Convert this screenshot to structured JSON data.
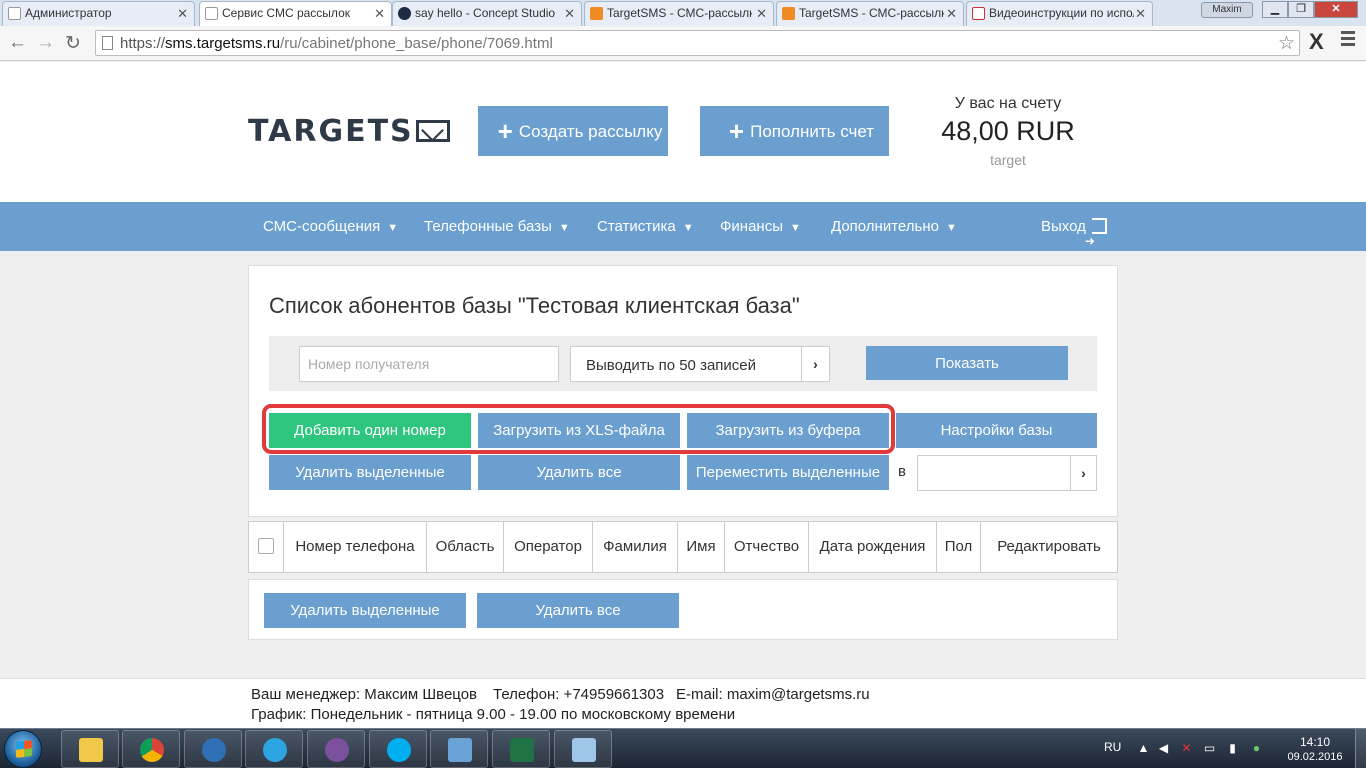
{
  "browser": {
    "tabs": [
      {
        "title": "Администратор",
        "icon": "page-icon",
        "active": false
      },
      {
        "title": "Сервис СМС рассылок",
        "icon": "page-icon",
        "active": true
      },
      {
        "title": "say hello - Concept Studio",
        "icon": "concept-studio-icon",
        "active": false
      },
      {
        "title": "TargetSMS - СМС-рассылки",
        "icon": "targetsms-icon",
        "active": false
      },
      {
        "title": "TargetSMS - СМС-рассылки",
        "icon": "targetsms-icon",
        "active": false
      },
      {
        "title": "Видеоинструкции по использованию",
        "icon": "gmail-icon",
        "active": false
      }
    ],
    "user": "Maxim",
    "url": {
      "scheme": "https://",
      "host": "sms.targetsms.ru",
      "path": "/ru/cabinet/phone_base/phone/7069.html"
    }
  },
  "header": {
    "logo": "TARGETS",
    "logo_suffix": "S",
    "create_button": "Создать рассылку",
    "topup_button": "Пополнить счет",
    "balance_caption": "У вас на счету",
    "balance_amount": "48,00 RUR",
    "account_login": "target"
  },
  "nav": {
    "items": [
      "СМС-сообщения",
      "Телефонные базы",
      "Статистика",
      "Финансы",
      "Дополнительно"
    ],
    "logout": "Выход"
  },
  "page": {
    "title": "Список абонентов базы \"Тестовая клиентская база\"",
    "search_placeholder": "Номер получателя",
    "per_page": "Выводить по 50 записей",
    "show_button": "Показать",
    "add_one": "Добавить один номер",
    "load_xls": "Загрузить из XLS-файла",
    "load_buffer": "Загрузить из буфера",
    "base_settings": "Настройки базы",
    "delete_selected": "Удалить выделенные",
    "delete_all": "Удалить все",
    "move_selected": "Переместить выделенные",
    "move_in_label": "в"
  },
  "table": {
    "columns": [
      "Номер телефона",
      "Область",
      "Оператор",
      "Фамилия",
      "Имя",
      "Отчество",
      "Дата рождения",
      "Пол",
      "Редактировать"
    ]
  },
  "bottom": {
    "delete_selected": "Удалить выделенные",
    "delete_all": "Удалить все"
  },
  "footer": {
    "manager": "Ваш менеджер: Максим Швецов",
    "phone": "Телефон: +74959661303",
    "email": "E-mail: maxim@targetsms.ru",
    "schedule": "График: Понедельник - пятница 9.00 - 19.00 по московскому времени"
  },
  "taskbar": {
    "lang": "RU",
    "time": "14:10",
    "date": "09.02.2016"
  },
  "colors": {
    "primary": "#6a9fd0",
    "green": "#2ec57e",
    "highlight": "#e03a3a"
  }
}
